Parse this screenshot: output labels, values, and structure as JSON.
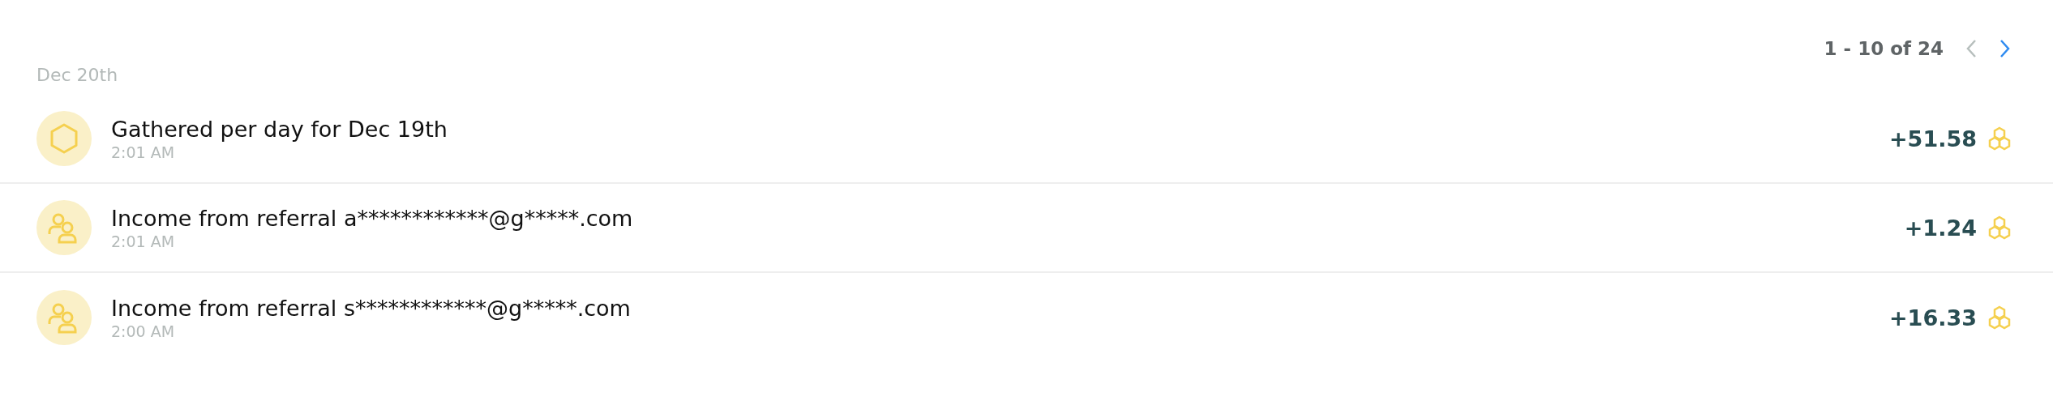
{
  "pagination": {
    "range": "1 - 10 of 24",
    "prev": {
      "disabled": true
    },
    "next": {
      "disabled": false
    }
  },
  "date_heading": "Dec 20th",
  "transactions": [
    {
      "kind": "daily",
      "title": "Gathered per day for Dec 19th",
      "time": "2:01 AM",
      "amount": "+51.58"
    },
    {
      "kind": "referral",
      "title": "Income from referral a************@g*****.com",
      "time": "2:01 AM",
      "amount": "+1.24"
    },
    {
      "kind": "referral",
      "title": "Income from referral s************@g*****.com",
      "time": "2:00 AM",
      "amount": "+16.33"
    }
  ]
}
